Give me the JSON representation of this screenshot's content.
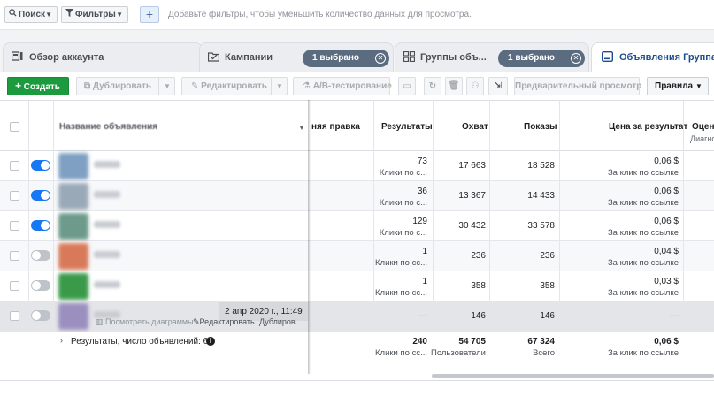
{
  "filterbar": {
    "search_label": "Поиск",
    "filters_label": "Фильтры",
    "add_label": "+",
    "hint": "Добавьте фильтры, чтобы уменьшить количество данных для просмотра."
  },
  "tabs": [
    {
      "label": "Обзор аккаунта",
      "icon": "account-overview-icon"
    },
    {
      "label": "Кампании",
      "icon": "campaigns-folder-icon",
      "chip": "1 выбрано"
    },
    {
      "label": "Группы объ...",
      "icon": "adsets-grid-icon",
      "chip": "1 выбрано"
    },
    {
      "label": "Объявления Группа о",
      "icon": "ads-icon"
    }
  ],
  "toolbar": {
    "create": "Создать",
    "duplicate": "Дублировать",
    "edit": "Редактировать",
    "ab_test": "A/B-тестирование",
    "preview": "Предварительный просмотр",
    "rules": "Правила"
  },
  "columns": {
    "name": "Название объявления",
    "last_edit": "няя правка",
    "results": "Результаты",
    "reach": "Охват",
    "impressions": "Показы",
    "cost_per_result": "Цена за результат",
    "rating": "Оцен",
    "rating_sub": "Диагно"
  },
  "rows": [
    {
      "on": true,
      "results": "73",
      "results_sub": "Клики по с...",
      "reach": "17 663",
      "impressions": "18 528",
      "cost": "0,06 $",
      "cost_sub": "За клик по ссылке",
      "thumb": "#7fa0c2"
    },
    {
      "on": true,
      "results": "36",
      "results_sub": "Клики по с...",
      "reach": "13 367",
      "impressions": "14 433",
      "cost": "0,06 $",
      "cost_sub": "За клик по ссылке",
      "thumb": "#9aa9b8"
    },
    {
      "on": true,
      "results": "129",
      "results_sub": "Клики по с...",
      "reach": "30 432",
      "impressions": "33 578",
      "cost": "0,06 $",
      "cost_sub": "За клик по ссылке",
      "thumb": "#6d9a8a"
    },
    {
      "on": false,
      "results": "1",
      "results_sub": "Клики по сс...",
      "reach": "236",
      "impressions": "236",
      "cost": "0,04 $",
      "cost_sub": "За клик по ссылке",
      "thumb": "#d87a5a"
    },
    {
      "on": false,
      "results": "1",
      "results_sub": "Клики по сс...",
      "reach": "358",
      "impressions": "358",
      "cost": "0,03 $",
      "cost_sub": "За клик по ссылке",
      "thumb": "#3a9a4a"
    },
    {
      "on": false,
      "results": "—",
      "results_sub": "",
      "reach": "146",
      "impressions": "146",
      "cost": "—",
      "cost_sub": "",
      "thumb": "#9b8fc0"
    }
  ],
  "hover_row": {
    "tooltip": "2 апр 2020 г., 11:49",
    "view_charts": "Посмотреть диаграммы",
    "edit": "Редактировать",
    "duplicate": "Дублиров"
  },
  "totals": {
    "label": "Результаты, число объявлений: 6",
    "results": "240",
    "results_sub": "Клики по сс...",
    "reach": "54 705",
    "reach_sub": "Пользователи",
    "impressions": "67 324",
    "impressions_sub": "Всего",
    "cost": "0,06 $",
    "cost_sub": "За клик по ссылке"
  },
  "colors": {
    "accent": "#1877f2",
    "create": "#1c9a3e",
    "chip": "#5b6b80",
    "active_tab": "#1d4e8f"
  }
}
